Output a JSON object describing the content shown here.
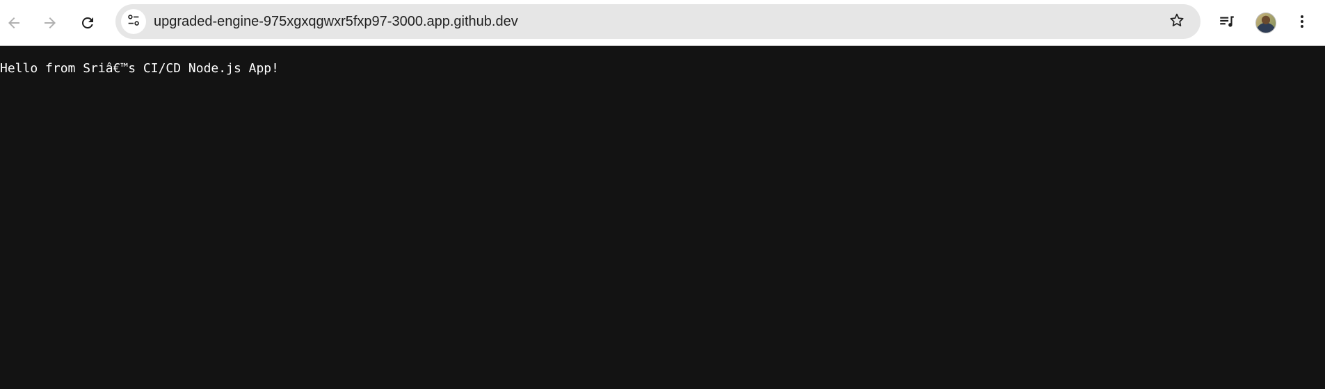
{
  "browser": {
    "url": "upgraded-engine-975xgxqgwxr5fxp97-3000.app.github.dev",
    "icons": {
      "back": "arrow-left-icon",
      "forward": "arrow-right-icon",
      "reload": "reload-icon",
      "site_info": "tune-icon",
      "bookmark": "star-icon",
      "media": "queue-music-icon",
      "profile": "avatar",
      "menu": "kebab-menu-icon"
    }
  },
  "page": {
    "text": "Hello from Sriâ€™s CI/CD Node.js App!"
  },
  "colors": {
    "page_background": "#131313",
    "page_text": "#ffffff",
    "omnibox": "#e6e6e6"
  }
}
